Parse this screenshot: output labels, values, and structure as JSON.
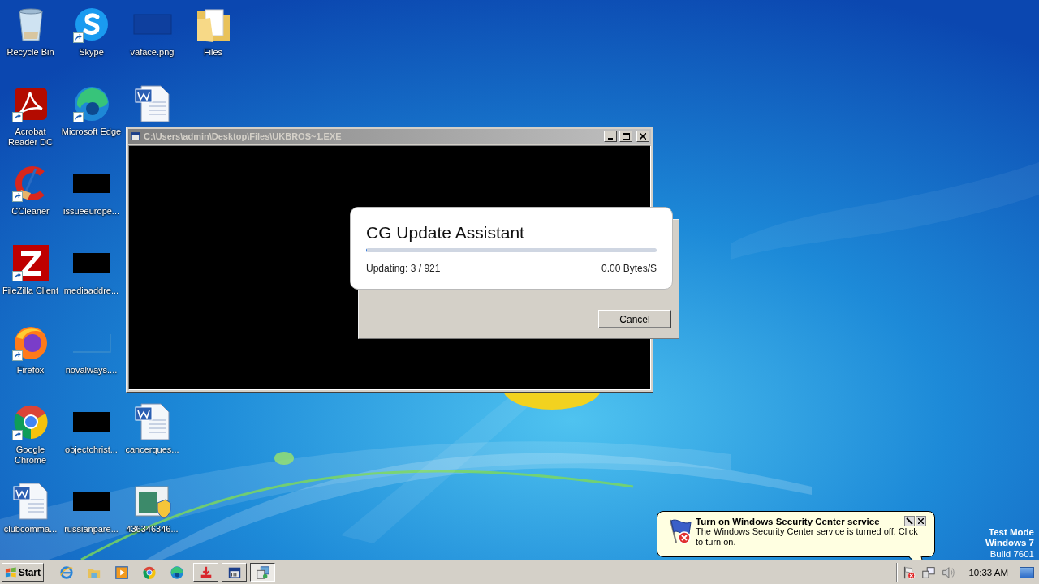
{
  "desktop_icons": [
    {
      "kind": "recycle",
      "label": "Recycle Bin",
      "shortcut": false
    },
    {
      "kind": "acrobat",
      "label": "Acrobat Reader DC",
      "shortcut": true
    },
    {
      "kind": "ccleaner",
      "label": "CCleaner",
      "shortcut": true
    },
    {
      "kind": "filezilla",
      "label": "FileZilla Client",
      "shortcut": true
    },
    {
      "kind": "firefox",
      "label": "Firefox",
      "shortcut": true
    },
    {
      "kind": "chrome",
      "label": "Google Chrome",
      "shortcut": true
    },
    {
      "kind": "word",
      "label": "clubcomma...",
      "shortcut": false
    },
    {
      "kind": "skype",
      "label": "Skype",
      "shortcut": true
    },
    {
      "kind": "edge",
      "label": "Microsoft Edge",
      "shortcut": true
    },
    {
      "kind": "redacted",
      "label": "issueeurope...",
      "shortcut": false
    },
    {
      "kind": "redacted",
      "label": "mediaaddre...",
      "shortcut": false
    },
    {
      "kind": "blank",
      "label": "novalways....",
      "shortcut": false
    },
    {
      "kind": "redacted",
      "label": "objectchrist...",
      "shortcut": false
    },
    {
      "kind": "redacted",
      "label": "russianpare...",
      "shortcut": false
    },
    {
      "kind": "dark-image",
      "label": "vaface.png",
      "shortcut": false
    },
    {
      "kind": "word",
      "shortcut": false
    },
    {
      "kind": "empty"
    },
    {
      "kind": "empty"
    },
    {
      "kind": "empty"
    },
    {
      "kind": "word",
      "label": "cancerques...",
      "shortcut": false
    },
    {
      "kind": "installer",
      "label": "436346346...",
      "shortcut": false
    },
    {
      "kind": "folder",
      "label": "Files",
      "shortcut": false
    }
  ],
  "console_window": {
    "title": "C:\\Users\\admin\\Desktop\\Files\\UKBROS~1.EXE"
  },
  "dialog": {
    "title": "CG Update Assistant",
    "progress": {
      "level": 0.003
    },
    "status": "Updating: 3 / 921",
    "speed": "0.00 Bytes/S",
    "buttons": [
      "Cancel"
    ]
  },
  "balloon": {
    "title": "Turn on Windows Security Center service",
    "message": "The Windows Security Center service is turned off. Click to turn on."
  },
  "os_info": [
    "Test Mode",
    "Windows 7",
    "Build 7601"
  ],
  "taskbar": {
    "start": "Start",
    "pinned": [
      {
        "kind": "ie"
      },
      {
        "kind": "explorer"
      },
      {
        "kind": "media"
      },
      {
        "kind": "chrome"
      },
      {
        "kind": "edge"
      }
    ],
    "tasks": [
      {
        "kind": "download",
        "selected": false
      },
      {
        "kind": "console",
        "selected": false
      },
      {
        "kind": "installer",
        "selected": true
      }
    ],
    "tray": [
      {
        "kind": "security"
      },
      {
        "kind": "network"
      },
      {
        "kind": "speaker"
      }
    ],
    "clock": "10:33 AM"
  }
}
